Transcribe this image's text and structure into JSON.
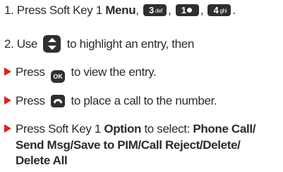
{
  "steps": [
    {
      "number": "1.",
      "text_pre": "Press Soft Key 1",
      "bold": "Menu",
      "keys": [
        {
          "main": "3",
          "sub": "def",
          "icon": "key-3-def"
        },
        {
          "main": "1",
          "sub": "",
          "icon": "key-1-voicemail"
        },
        {
          "main": "4",
          "sub": "ghi",
          "icon": "key-4-ghi"
        }
      ]
    },
    {
      "number": "2.",
      "text_pre": "Use",
      "icon": "navigation-key-icon",
      "text_post": "to highlight an entry, then"
    }
  ],
  "bullets": [
    {
      "text_pre": "Press",
      "key_label": "OK",
      "text_post": "to view the entry."
    },
    {
      "text_pre": "Press",
      "icon": "send-key-icon",
      "text_post": "to place a call to the number."
    },
    {
      "text_pre": "Press Soft Key 1",
      "bold1": "Option",
      "text_mid": "to select:",
      "bold2": "Phone Call/",
      "line2": "Send Msg/Save to PIM/Call Reject/Delete/",
      "line3": "Delete All"
    }
  ],
  "colors": {
    "bullet_arrow": "#d9261c",
    "key_bg": "#2f2f2f"
  }
}
